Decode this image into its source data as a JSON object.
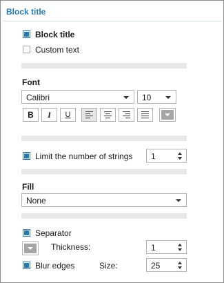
{
  "header": {
    "title": "Block title"
  },
  "title_options": {
    "block_title_label": "Block title",
    "block_title_checked": true,
    "custom_text_label": "Custom text",
    "custom_text_checked": false
  },
  "font": {
    "section_label": "Font",
    "family": "Calibri",
    "size": "10",
    "bold_label": "B",
    "italic_label": "I",
    "underline_label": "U",
    "alignments": [
      "align-left-icon",
      "align-center-icon",
      "align-right-icon",
      "align-justify-icon"
    ],
    "active_alignment": "align-left-icon",
    "color": "#a6a6a6"
  },
  "strings": {
    "limit_label": "Limit the number of strings",
    "limit_checked": true,
    "limit_value": "1"
  },
  "fill": {
    "section_label": "Fill",
    "value": "None"
  },
  "separator": {
    "label": "Separator",
    "checked": true,
    "color": "#a6a6a6",
    "thickness_label": "Thickness:",
    "thickness_value": "1",
    "blur_label": "Blur edges",
    "blur_checked": true,
    "size_label": "Size:",
    "size_value": "25"
  },
  "colors": {
    "accent": "#2a7ab8",
    "separator_bar": "#e8e8e8"
  }
}
